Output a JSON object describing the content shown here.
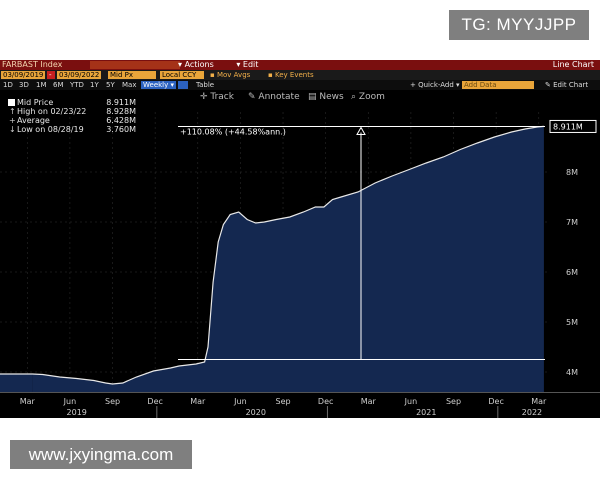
{
  "watermarks": {
    "top": "TG: MYYJJPP",
    "bottom": "www.jxyingma.com"
  },
  "titlebar": {
    "ticker": "FARBAST Index",
    "menu_actions": "Actions",
    "menu_edit": "Edit",
    "right": "Line Chart"
  },
  "controls": {
    "start_date": "03/09/2019",
    "end_date": "03/09/2022",
    "field": "Mid Px",
    "currency": "Local CCY",
    "mov_avgs": "Mov Avgs",
    "key_events": "Key Events",
    "periods": [
      "1D",
      "3D",
      "1M",
      "6M",
      "YTD",
      "1Y",
      "5Y",
      "Max"
    ],
    "frequency": "Weekly",
    "table": "Table",
    "quick_add": "Quick-Add",
    "add_data": "Add Data",
    "edit_chart": "Edit Chart"
  },
  "toolbar": {
    "track": "Track",
    "annotate": "Annotate",
    "news": "News",
    "zoom": "Zoom"
  },
  "legend": [
    {
      "label": "Mid Price",
      "value": "8.911M"
    },
    {
      "label": "High on 02/23/22",
      "value": "8.928M"
    },
    {
      "label": "Average",
      "value": "6.428M"
    },
    {
      "label": "Low on 08/28/19",
      "value": "3.760M"
    }
  ],
  "annotation": "+110.08% (+44.58%ann.)",
  "last_value_label": "8.911M",
  "chart_data": {
    "type": "area",
    "x_unit": "year",
    "x": [
      2019.19,
      2019.25,
      2019.35,
      2019.45,
      2019.55,
      2019.62,
      2019.66,
      2019.72,
      2019.8,
      2019.9,
      2020.0,
      2020.05,
      2020.1,
      2020.15,
      2020.2,
      2020.22,
      2020.25,
      2020.28,
      2020.31,
      2020.35,
      2020.4,
      2020.45,
      2020.5,
      2020.55,
      2020.62,
      2020.7,
      2020.78,
      2020.85,
      2020.9,
      2020.95,
      2021.0,
      2021.1,
      2021.2,
      2021.3,
      2021.4,
      2021.5,
      2021.6,
      2021.7,
      2021.8,
      2021.9,
      2022.0,
      2022.08,
      2022.15,
      2022.19
    ],
    "y": [
      3.96,
      3.95,
      3.9,
      3.87,
      3.83,
      3.78,
      3.76,
      3.78,
      3.9,
      4.02,
      4.08,
      4.12,
      4.14,
      4.16,
      4.2,
      4.5,
      5.8,
      6.6,
      6.95,
      7.15,
      7.2,
      7.05,
      6.98,
      7.0,
      7.05,
      7.1,
      7.2,
      7.3,
      7.3,
      7.45,
      7.5,
      7.6,
      7.78,
      7.92,
      8.05,
      8.18,
      8.3,
      8.45,
      8.58,
      8.7,
      8.8,
      8.86,
      8.9,
      8.911
    ],
    "yticks": [
      "4M",
      "5M",
      "6M",
      "7M",
      "8M"
    ],
    "ylim": [
      3.6,
      9.2
    ],
    "xlim": [
      2019.0,
      2022.22
    ],
    "month_labels": [
      "Mar",
      "Jun",
      "Sep",
      "Dec",
      "Mar",
      "Jun",
      "Sep",
      "Dec",
      "Mar",
      "Jun",
      "Sep",
      "Dec",
      "Mar"
    ],
    "year_labels": [
      "2019",
      "2020",
      "2021",
      "2022"
    ],
    "ref_level": 4.25,
    "legend_position": "top-left",
    "line_color": "#e8e8e8",
    "fill_color": "#142850"
  }
}
